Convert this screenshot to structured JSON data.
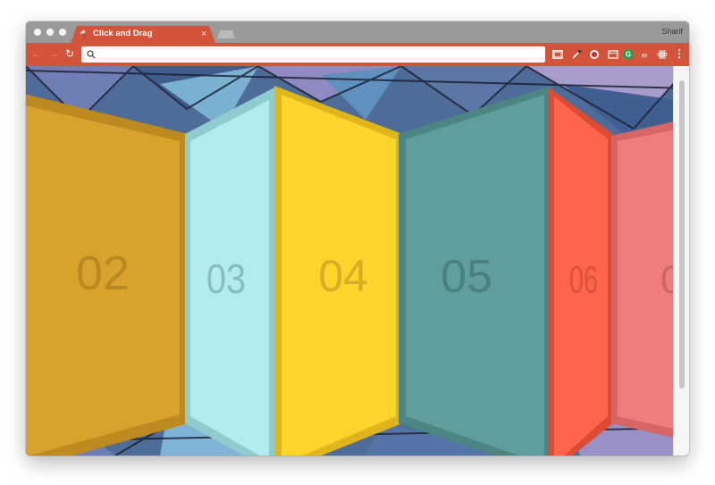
{
  "window": {
    "tab_title": "Click and Drag",
    "tab_close": "×",
    "profile_name": "Sharif"
  },
  "toolbar": {
    "back": "←",
    "forward": "→",
    "reload": "↻",
    "address_value": "",
    "menu": "⋮",
    "extension_icons": [
      "screen-capture-icon",
      "eyedropper-icon",
      "bug-icon",
      "window-icon",
      "grammarly-icon",
      "m-icon",
      "react-devtools-icon"
    ]
  },
  "panels": [
    {
      "label": "02",
      "color": "#d9a32b",
      "shade": "#bd8a22"
    },
    {
      "label": "03",
      "color": "#b2ecee",
      "shade": "#8fcccf"
    },
    {
      "label": "04",
      "color": "#fdd42c",
      "shade": "#e0b41b"
    },
    {
      "label": "05",
      "color": "#5f9e9c",
      "shade": "#4c8582"
    },
    {
      "label": "06",
      "color": "#fe654b",
      "shade": "#dc4b33"
    },
    {
      "label": "0",
      "color": "#ef7d7d",
      "shade": "#d86565"
    }
  ],
  "colors": {
    "browser_accent": "#d4533b",
    "tab_strip": "#9a9a9a"
  }
}
